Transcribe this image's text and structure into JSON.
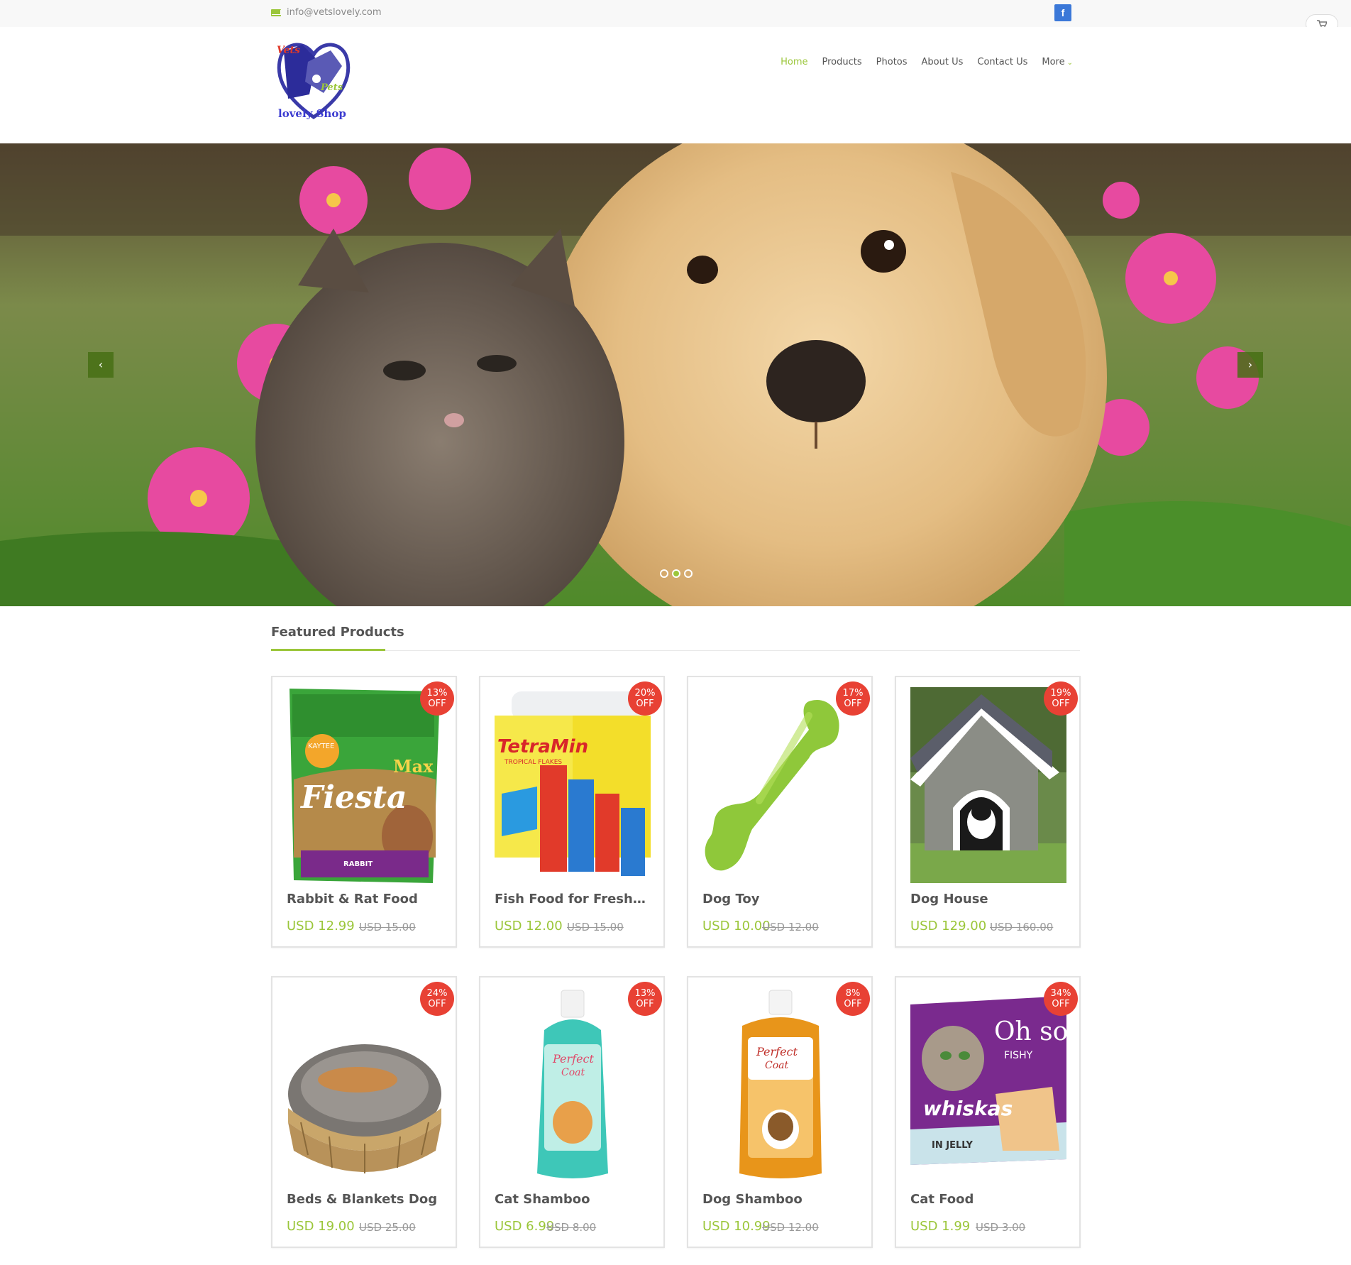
{
  "topbar": {
    "email": "info@vetslovely.com",
    "facebook_label": "f"
  },
  "logo": {
    "line1": "Vets",
    "line2": "Pets",
    "line3": "lovely Shop"
  },
  "nav": [
    {
      "label": "Home",
      "active": true
    },
    {
      "label": "Products"
    },
    {
      "label": "Photos"
    },
    {
      "label": "About Us"
    },
    {
      "label": "Contact Us"
    },
    {
      "label": "More",
      "has_dropdown": true
    }
  ],
  "hero": {
    "slide_count": 3,
    "active_slide": 2,
    "prev_icon": "chevron-left-icon",
    "next_icon": "chevron-right-icon"
  },
  "featured": {
    "title": "Featured Products",
    "products": [
      {
        "name": "Rabbit & Rat Food",
        "price": "USD 12.99",
        "old_price": "USD 15.00",
        "discount_pct": "13%",
        "discount_word": "OFF"
      },
      {
        "name": "Fish Food for Freshwat...",
        "price": "USD 12.00",
        "old_price": "USD 15.00",
        "discount_pct": "20%",
        "discount_word": "OFF"
      },
      {
        "name": "Dog Toy",
        "price": "USD 10.00",
        "old_price": "USD 12.00",
        "discount_pct": "17%",
        "discount_word": "OFF"
      },
      {
        "name": "Dog House",
        "price": "USD 129.00",
        "old_price": "USD 160.00",
        "discount_pct": "19%",
        "discount_word": "OFF"
      },
      {
        "name": "Beds & Blankets Dog",
        "price": "USD 19.00",
        "old_price": "USD 25.00",
        "discount_pct": "24%",
        "discount_word": "OFF"
      },
      {
        "name": "Cat Shamboo",
        "price": "USD 6.99",
        "old_price": "USD 8.00",
        "discount_pct": "13%",
        "discount_word": "OFF"
      },
      {
        "name": "Dog Shamboo",
        "price": "USD 10.99",
        "old_price": "USD 12.00",
        "discount_pct": "8%",
        "discount_word": "OFF"
      },
      {
        "name": "Cat Food",
        "price": "USD 1.99",
        "old_price": "USD 3.00",
        "discount_pct": "34%",
        "discount_word": "OFF"
      }
    ]
  },
  "packaging_text": {
    "p1": [
      "Fiesta",
      "Max",
      "KAYTEE",
      "RABBIT"
    ],
    "p2": [
      "TetraMin",
      "TROPICAL FLAKES"
    ],
    "p6": [
      "Perfect",
      "Coat"
    ],
    "p7": [
      "Perfect",
      "Coat"
    ],
    "p8": [
      "whiskas",
      "Oh so",
      "FISHY",
      "IN JELLY"
    ]
  },
  "colors": {
    "accent": "#9bc63a",
    "badge": "#e84134",
    "facebook": "#3b78d8"
  }
}
